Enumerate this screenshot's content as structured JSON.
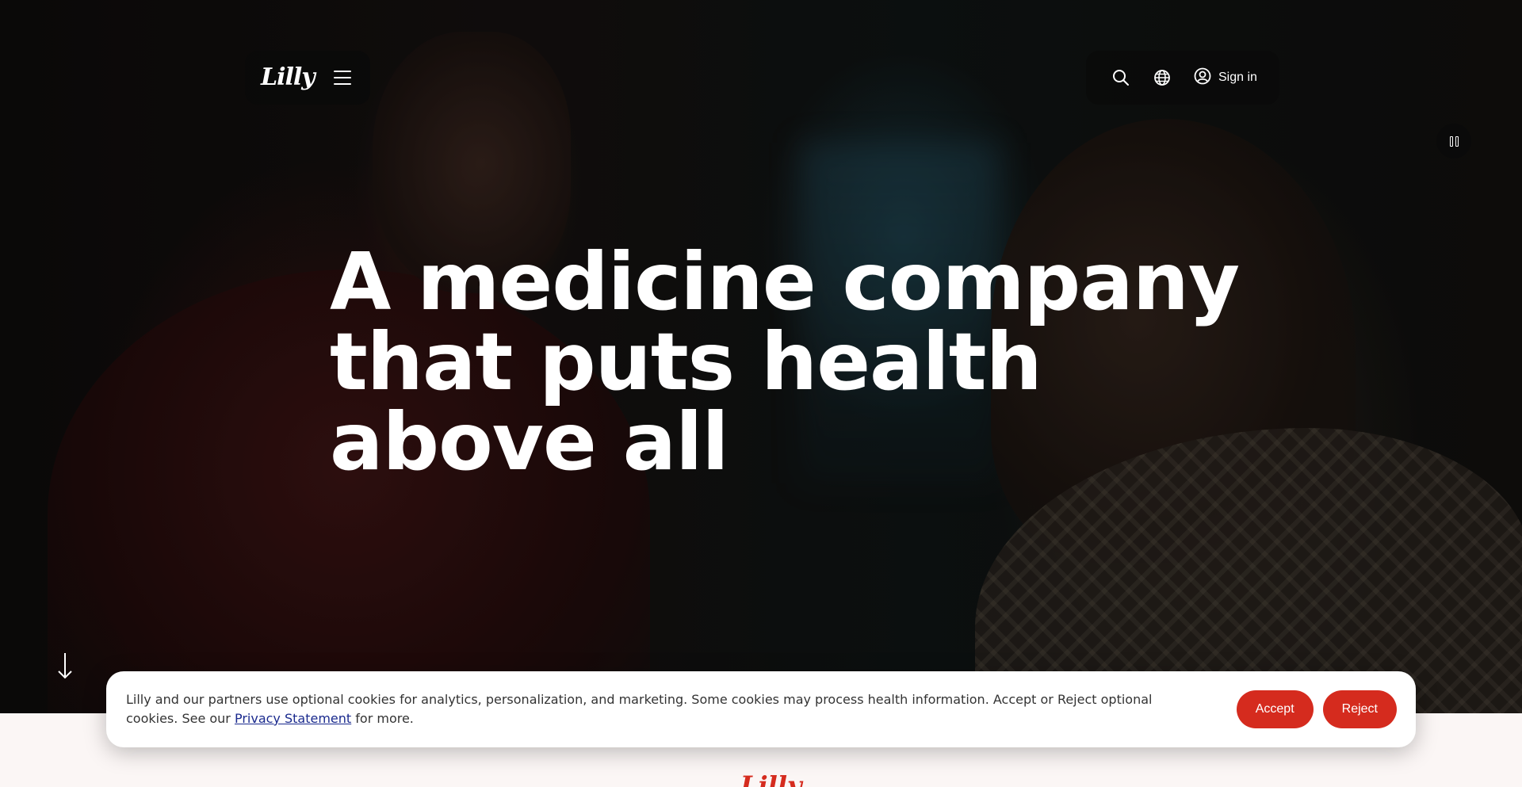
{
  "nav": {
    "logo": "Lilly",
    "signin_label": "Sign in",
    "icons": [
      "menu-icon",
      "search-icon",
      "globe-icon",
      "user-icon",
      "pause-icon",
      "arrow-down-icon"
    ]
  },
  "hero": {
    "line1": "A medicine company",
    "line2": "that puts health",
    "line3": "above all"
  },
  "cookie": {
    "text": "Lilly and our partners use optional cookies for analytics, personalization, and marketing. Some cookies may process health information. Accept or Reject optional cookies. See our ",
    "link": "Privacy Statement",
    "suffix": " for more.",
    "accept": "Accept",
    "reject": "Reject"
  },
  "footer": {
    "logo": "Lilly"
  },
  "colors": {
    "brand_red": "#d52b1e",
    "link_blue": "#1a2a8e"
  }
}
